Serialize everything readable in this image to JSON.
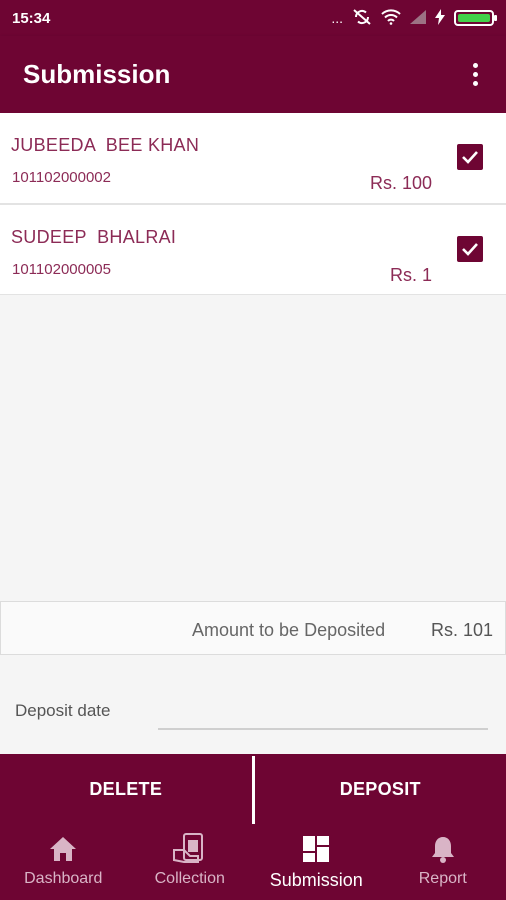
{
  "status_bar": {
    "time": "15:34",
    "icons": [
      "more-dots-icon",
      "sync-off-icon",
      "wifi-icon",
      "signal-icon",
      "charging-icon",
      "battery-icon"
    ],
    "overflow_dots": "..."
  },
  "app_bar": {
    "title": "Submission",
    "menu_icon": "more-vert-icon"
  },
  "submissions": [
    {
      "name": "JUBEEDA  BEE KHAN",
      "account": "101102000002",
      "amount": "Rs. 100",
      "checked": true
    },
    {
      "name": "SUDEEP  BHALRAI",
      "account": "101102000005",
      "amount": "Rs. 1",
      "checked": true
    }
  ],
  "total": {
    "label": "Amount to be Deposited",
    "value": "Rs. 101"
  },
  "deposit_date": {
    "label": "Deposit date",
    "value": ""
  },
  "actions": {
    "delete_label": "DELETE",
    "deposit_label": "DEPOSIT"
  },
  "bottom_nav": [
    {
      "label": "Dashboard",
      "icon": "home-icon",
      "active": false
    },
    {
      "label": "Collection",
      "icon": "collection-icon",
      "active": false
    },
    {
      "label": "Submission",
      "icon": "dashboard-grid-icon",
      "active": true
    },
    {
      "label": "Report",
      "icon": "bell-icon",
      "active": false
    }
  ],
  "colors": {
    "brand": "#6e0533",
    "text_accent": "#8c2b56",
    "battery": "#43d14a"
  }
}
